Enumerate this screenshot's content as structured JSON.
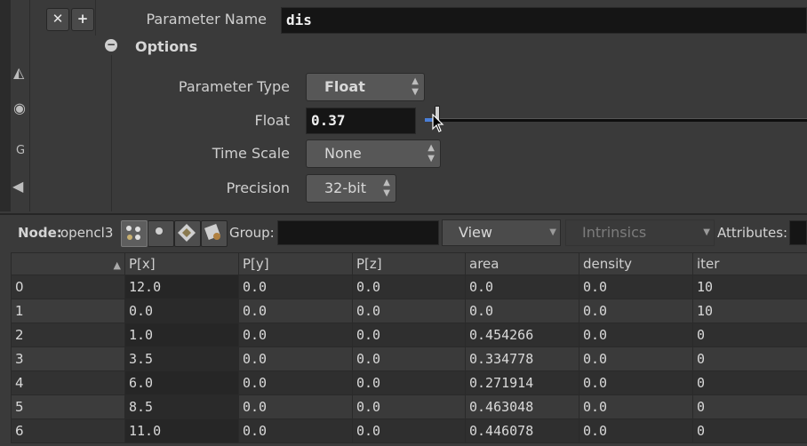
{
  "param_panel": {
    "close_icon": "x-icon",
    "add_icon": "plus-icon",
    "parameter_name_label": "Parameter Name",
    "parameter_name_value": "dis",
    "options_label": "Options",
    "parameter_type_label": "Parameter Type",
    "parameter_type_value": "Float",
    "float_label": "Float",
    "float_value": "0.37",
    "float_slider_fraction": 0.03,
    "time_scale_label": "Time Scale",
    "time_scale_value": "None",
    "precision_label": "Precision",
    "precision_value": "32-bit"
  },
  "left_strip": {
    "partial_label": "G"
  },
  "spreadsheet": {
    "node_label": "Node:",
    "node_value": "opencl3",
    "group_label": "Group:",
    "group_value": "",
    "view_label": "View",
    "intrinsics_label": "Intrinsics",
    "attributes_label": "Attributes:",
    "sort_indicator": "▲",
    "columns": [
      "",
      "P[x]",
      "P[y]",
      "P[z]",
      "area",
      "density",
      "iter"
    ],
    "rows": [
      [
        "0",
        "12.0",
        "0.0",
        "0.0",
        "0.0",
        "0.0",
        "10"
      ],
      [
        "1",
        "0.0",
        "0.0",
        "0.0",
        "0.0",
        "0.0",
        "10"
      ],
      [
        "2",
        "1.0",
        "0.0",
        "0.0",
        "0.454266",
        "0.0",
        "0"
      ],
      [
        "3",
        "3.5",
        "0.0",
        "0.0",
        "0.334778",
        "0.0",
        "0"
      ],
      [
        "4",
        "6.0",
        "0.0",
        "0.0",
        "0.271914",
        "0.0",
        "0"
      ],
      [
        "5",
        "8.5",
        "0.0",
        "0.0",
        "0.463048",
        "0.0",
        "0"
      ],
      [
        "6",
        "11.0",
        "0.0",
        "0.0",
        "0.446078",
        "0.0",
        "0"
      ]
    ]
  },
  "colors": {
    "panel_bg": "#3a3a3a",
    "field_bg": "#151515",
    "slider_accent": "#4a7fd8"
  }
}
